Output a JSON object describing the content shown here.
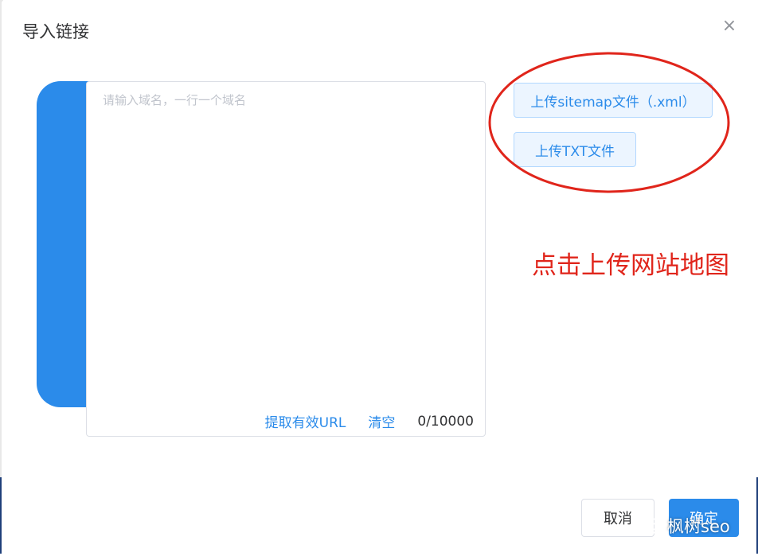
{
  "dialog": {
    "title": "导入链接",
    "close_icon": "close-icon"
  },
  "textarea": {
    "placeholder": "请输入域名，一行一个域名",
    "value": ""
  },
  "footer_links": {
    "extract": "提取有效URL",
    "clear": "清空",
    "counter": "0/10000"
  },
  "upload": {
    "sitemap_label": "上传sitemap文件（.xml）",
    "txt_label": "上传TXT文件"
  },
  "annotation": {
    "text": "点击上传网站地图",
    "color": "#e0251b"
  },
  "actions": {
    "cancel_label": "取消",
    "confirm_label": "确定"
  },
  "watermark": {
    "text": "枫树seo",
    "icon": "wechat-icon"
  },
  "colors": {
    "accent": "#2b8bea",
    "highlight": "#e0251b"
  }
}
